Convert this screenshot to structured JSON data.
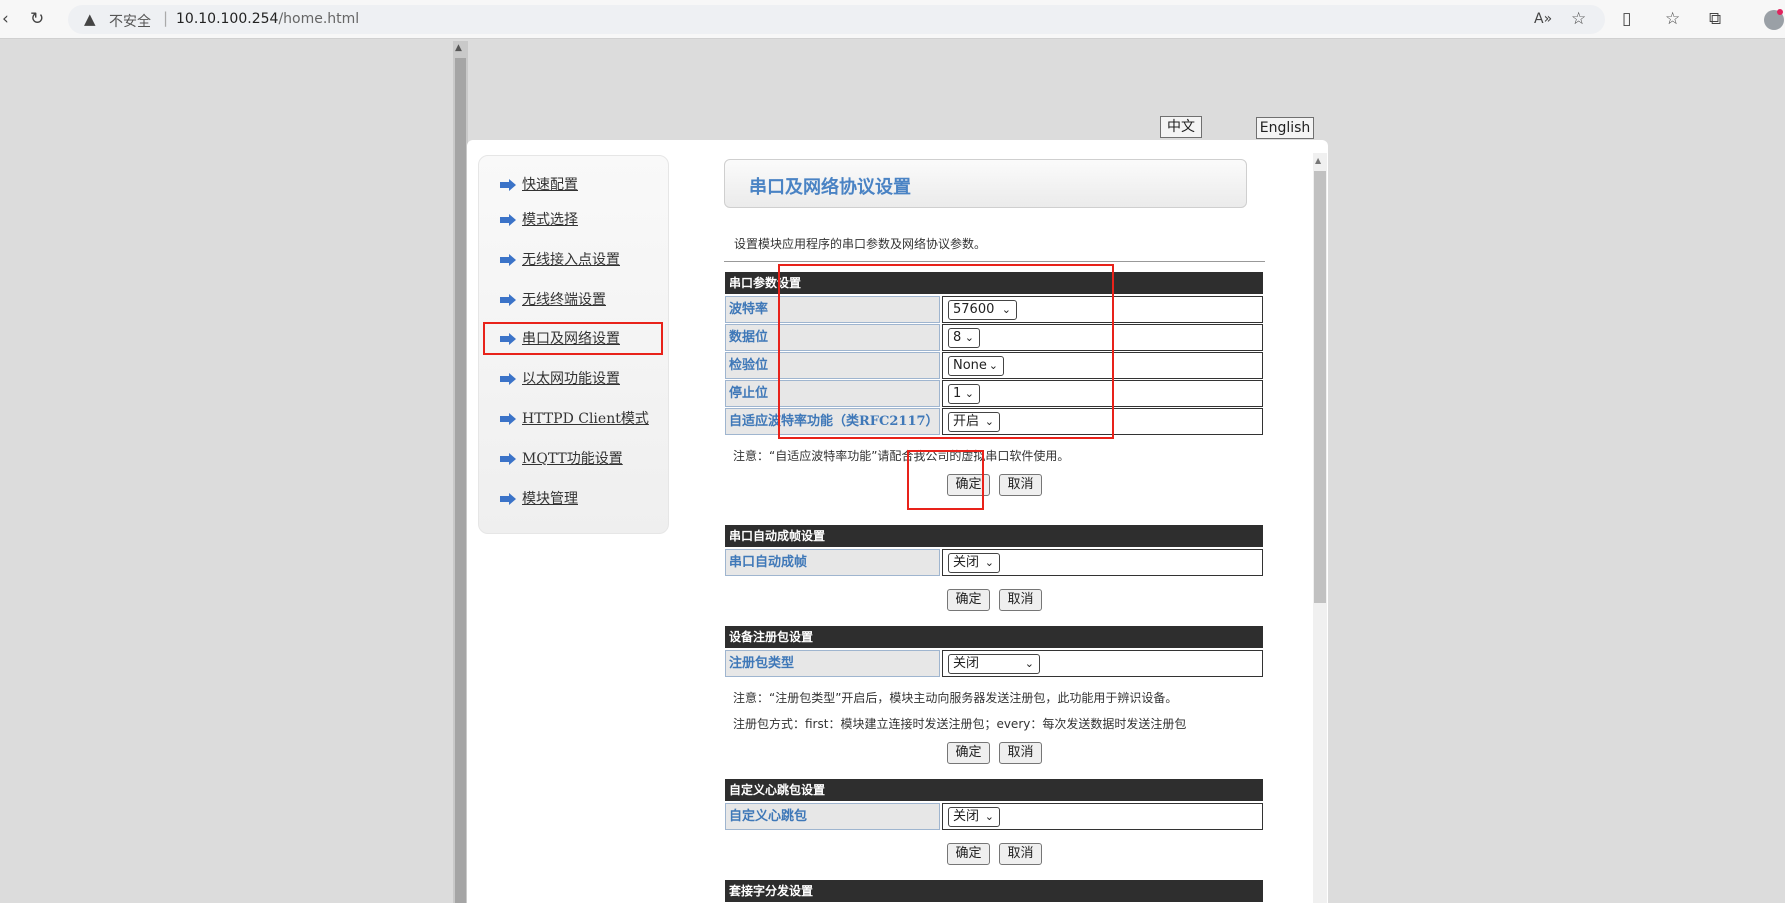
{
  "browser": {
    "insecure_label": "不安全",
    "url_host": "10.10.100.254",
    "url_path": "/home.html"
  },
  "lang_buttons": {
    "chinese": "中文",
    "english": "English"
  },
  "sidebar": {
    "items": [
      {
        "label": "快速配置"
      },
      {
        "label": "模式选择"
      },
      {
        "label": "无线接入点设置"
      },
      {
        "label": "无线终端设置"
      },
      {
        "label": "串口及网络设置"
      },
      {
        "label": "以太网功能设置"
      },
      {
        "label": "HTTPD Client模式"
      },
      {
        "label": "MQTT功能设置"
      },
      {
        "label": "模块管理"
      }
    ]
  },
  "main": {
    "title": "串口及网络协议设置",
    "description": "设置模块应用程序的串口参数及网络协议参数。",
    "serial": {
      "header": "串口参数设置",
      "rows": [
        {
          "label": "波特率",
          "value": "57600"
        },
        {
          "label": "数据位",
          "value": "8"
        },
        {
          "label": "检验位",
          "value": "None"
        },
        {
          "label": "停止位",
          "value": "1"
        },
        {
          "label": "自适应波特率功能（类RFC2117）",
          "value": "开启"
        }
      ],
      "note": "注意：“自适应波特率功能”请配合我公司的虚拟串口软件使用。"
    },
    "autoframe": {
      "header": "串口自动成帧设置",
      "label": "串口自动成帧",
      "value": "关闭"
    },
    "register": {
      "header": "设备注册包设置",
      "label": "注册包类型",
      "value": "关闭",
      "note1": "注意：“注册包类型”开启后，模块主动向服务器发送注册包，此功能用于辨识设备。",
      "note2": "注册包方式：first：模块建立连接时发送注册包；every：每次发送数据时发送注册包"
    },
    "heartbeat": {
      "header": "自定义心跳包设置",
      "label": "自定义心跳包",
      "value": "关闭"
    },
    "socket": {
      "header": "套接字分发设置"
    },
    "buttons": {
      "ok": "确定",
      "cancel": "取消"
    }
  }
}
